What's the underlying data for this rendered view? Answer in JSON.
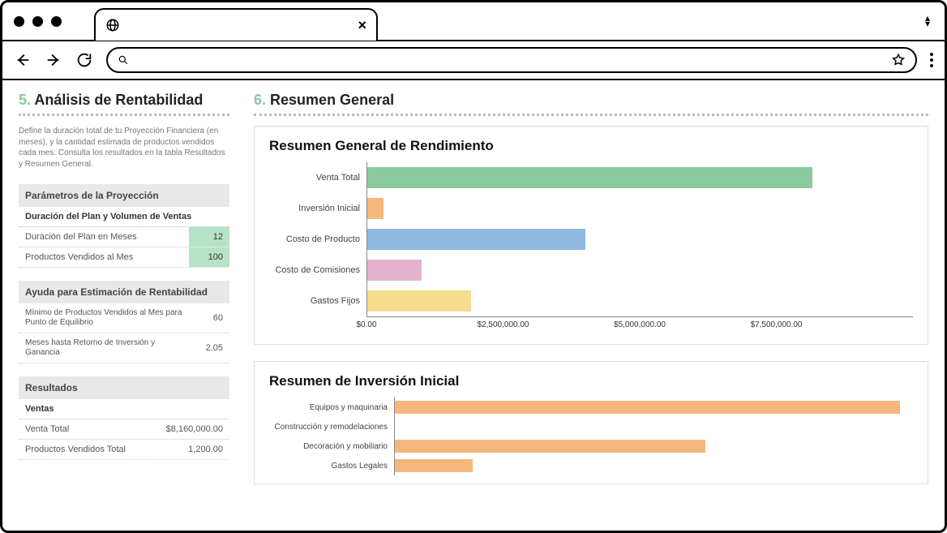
{
  "left": {
    "section_number": "5.",
    "section_title": "Análisis de Rentabilidad",
    "desc": "Define la duración total de tu Proyección Financiera (en meses), y la cantidad estimada de productos vendidos cada mes. Consulta los resultados en la tabla Resultados y Resumen General.",
    "params_header": "Parámetros de la Proyección",
    "dur_vol_header": "Duración del Plan y Volumen de Ventas",
    "row_dur_label": "Duración del Plan en Meses",
    "row_dur_val": "12",
    "row_prod_label": "Productos Vendidos al Mes",
    "row_prod_val": "100",
    "help_header": "Ayuda para Estimación de Rentabilidad",
    "row_min_label": "Mínimo de Productos Vendidos al Mes para Punto de Equilibrio",
    "row_min_val": "60",
    "row_roi_label": "Meses hasta Retorno de Inversión y Ganancia",
    "row_roi_val": "2.05",
    "results_header": "Resultados",
    "sales_header": "Ventas",
    "row_total_sale_label": "Venta Total",
    "row_total_sale_val": "$8,160,000.00",
    "row_total_prod_label": "Productos Vendidos Total",
    "row_total_prod_val": "1,200.00"
  },
  "right": {
    "section_number": "6.",
    "section_title": "Resumen General"
  },
  "chart_data": [
    {
      "type": "bar",
      "title": "Resumen General de Rendimiento",
      "categories": [
        "Venta Total",
        "Inversión Inicial",
        "Costo de Producto",
        "Costo de Comisiones",
        "Gastos Fijos"
      ],
      "values": [
        8160000,
        300000,
        4000000,
        1000000,
        1900000
      ],
      "colors": [
        "#8bc99e",
        "#f6b77c",
        "#8fb9e0",
        "#e3b3cd",
        "#f6dd8d"
      ],
      "xlim": [
        0,
        10000000
      ],
      "ticks": [
        0,
        2500000,
        5000000,
        7500000
      ],
      "tick_labels": [
        "$0.00",
        "$2,500,000.00",
        "$5,000,000.00",
        "$7,500,000.00"
      ]
    },
    {
      "type": "bar",
      "title": "Resumen de Inversión Inicial",
      "categories": [
        "Equipos y maquinaria",
        "Construcción y remodelaciones",
        "Decoración y mobiliario",
        "Gastos Legales"
      ],
      "values": [
        195000,
        0,
        120000,
        30000
      ],
      "colors": [
        "#f6b77c",
        "#f6b77c",
        "#f6b77c",
        "#f6b77c"
      ],
      "xlim": [
        0,
        200000
      ]
    }
  ]
}
